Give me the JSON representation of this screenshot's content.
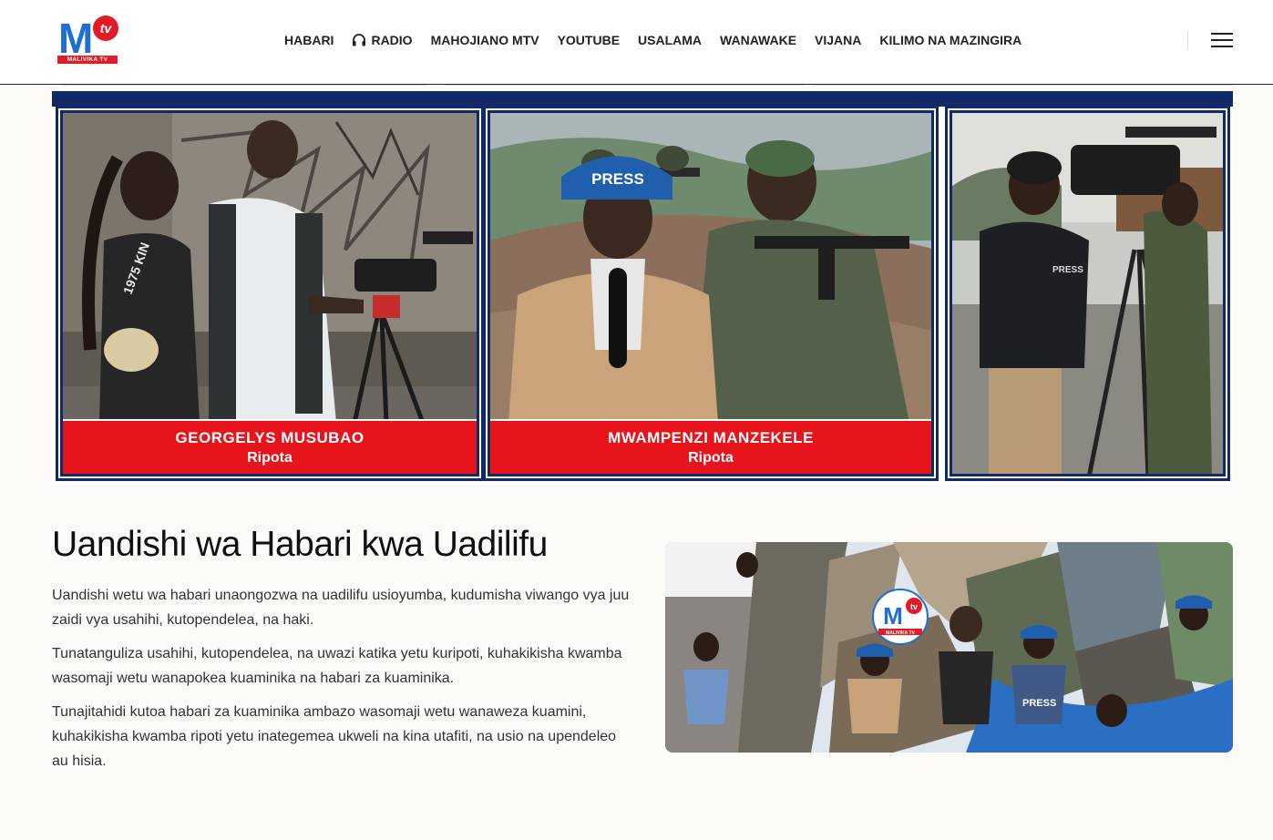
{
  "header": {
    "logo": {
      "main": "M",
      "badge": "tv",
      "band": "MALIVIKA TV"
    },
    "nav": [
      {
        "label": "HABARI",
        "icon": ""
      },
      {
        "label": "RADIO",
        "icon": "headphones-icon"
      },
      {
        "label": "MAHOJIANO MTV",
        "icon": ""
      },
      {
        "label": "YOUTUBE",
        "icon": ""
      },
      {
        "label": "USALAMA",
        "icon": ""
      },
      {
        "label": "WANAWAKE",
        "icon": ""
      },
      {
        "label": "VIJANA",
        "icon": ""
      },
      {
        "label": "KILIMO NA MAZINGIRA",
        "icon": ""
      }
    ],
    "menu_icon": "hamburger-menu-icon"
  },
  "banner": {
    "panels": [
      {
        "name": "GEORGELYS MUSUBAO",
        "role": "Ripota"
      },
      {
        "name": "MWAMPENZI  MANZEKELE",
        "role": "Ripota"
      },
      {
        "name": "",
        "role": ""
      }
    ],
    "helmet_text": "PRESS",
    "vest_text": "PRESS",
    "shirt_text": "1975 KIN"
  },
  "article": {
    "title": "Uandishi wa Habari kwa Uadilifu",
    "paragraphs": [
      "Uandishi wetu wa habari unaongozwa na uadilifu usioyumba, kudumisha viwango vya juu zaidi vya usahihi, kutopendelea, na haki.",
      "Tunatanguliza usahihi, kutopendelea, na uwazi katika yetu kuripoti, kuhakikisha kwamba wasomaji wetu wanapokea kuaminika na habari za kuaminika.",
      "Tunajitahidi kutoa habari za kuaminika ambazo wasomaji wetu wanaweza kuamini, kuhakikisha kwamba ripoti yetu inategemea ukweli na kina utafiti, na usio na upendeleo au hisia."
    ]
  },
  "collage": {
    "logo_main": "M",
    "logo_badge": "tv",
    "logo_band": "MALIVIKA TV",
    "press_label": "PRESS"
  },
  "colors": {
    "brand_blue": "#1e6fd1",
    "brand_red": "#e21c24",
    "banner_navy": "#0f2a66",
    "caption_red": "#e8141b"
  }
}
